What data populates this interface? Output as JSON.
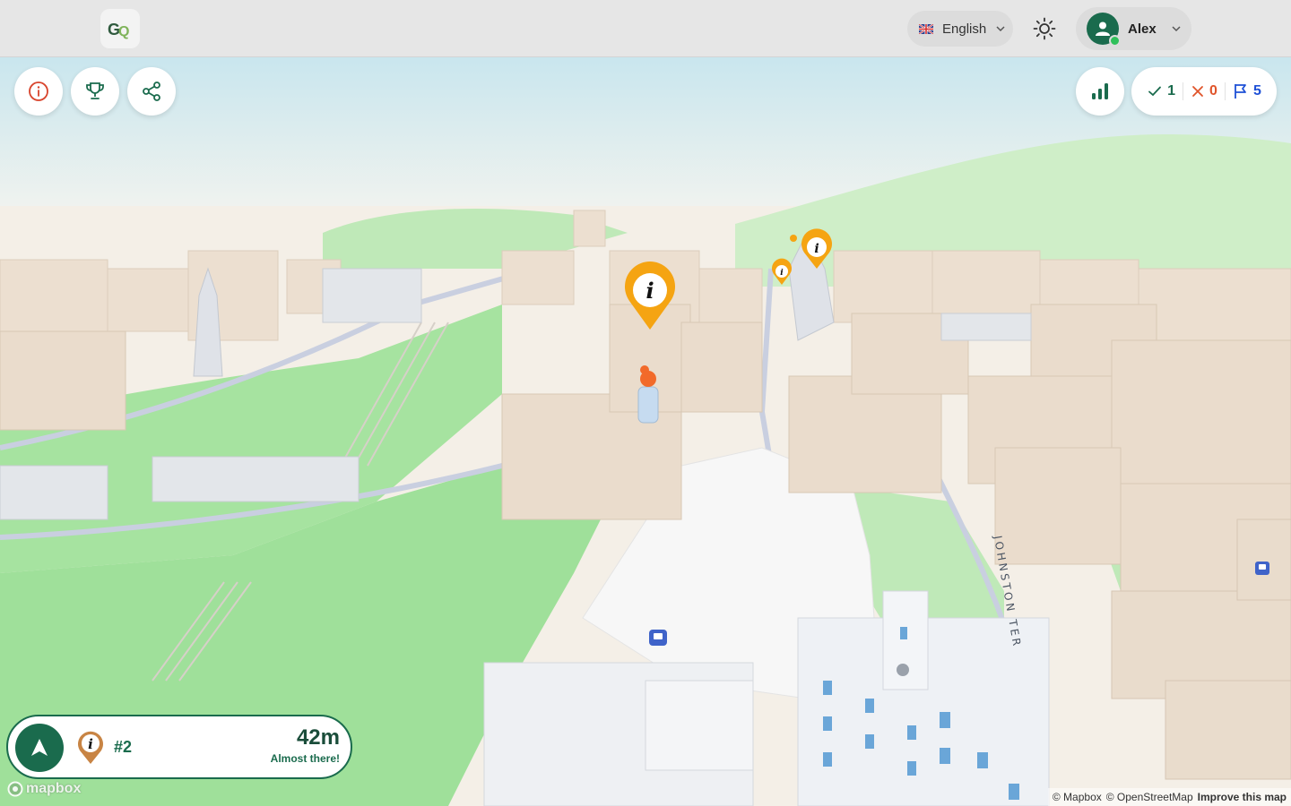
{
  "app": {
    "logo_text": "GQ"
  },
  "header": {
    "language": {
      "label": "English",
      "flag": "uk-flag-icon"
    },
    "theme_toggle": {
      "icon": "sun-icon"
    },
    "user": {
      "name": "Alex",
      "status": "online"
    }
  },
  "toolbar_left": [
    {
      "name": "info-button",
      "icon": "info-circle-icon"
    },
    {
      "name": "trophy-button",
      "icon": "trophy-icon"
    },
    {
      "name": "share-button",
      "icon": "share-icon"
    }
  ],
  "score": {
    "correct": "1",
    "wrong": "0",
    "flags": "5",
    "colors": {
      "correct": "#1a6b4d",
      "wrong": "#e0542a",
      "flags": "#1e50d6"
    }
  },
  "navigation": {
    "target_number": "#2",
    "distance": "42m",
    "status_text": "Almost there!"
  },
  "map": {
    "street_label": "JOHNSTON TER",
    "attribution": {
      "mapbox": "© Mapbox",
      "osm": "© OpenStreetMap",
      "improve": "Improve this map"
    },
    "logo": "mapbox"
  },
  "colors": {
    "brand_green": "#1a6b4d",
    "marker_orange": "#f5a412",
    "park_green": "#9fe09a",
    "building": "#ecdfd0"
  }
}
